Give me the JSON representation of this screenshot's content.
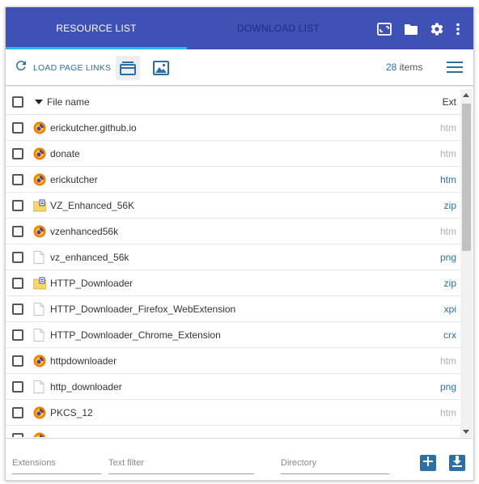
{
  "tabs": [
    {
      "label": "RESOURCE LIST",
      "active": true
    },
    {
      "label": "DOWNLOAD LIST",
      "active": false
    }
  ],
  "header_icons": [
    "fullscreen-icon",
    "folder-icon",
    "settings-icon",
    "more-vert-icon"
  ],
  "toolbar": {
    "load_label": "LOAD PAGE LINKS",
    "count_value": "28",
    "count_suffix": "items"
  },
  "table": {
    "col_name": "File name",
    "col_ext": "Ext",
    "rows": [
      {
        "name": "erickutcher.github.io",
        "ext": "htm",
        "icon": "firefox",
        "ext_dim": true
      },
      {
        "name": "donate",
        "ext": "htm",
        "icon": "firefox",
        "ext_dim": true
      },
      {
        "name": "erickutcher",
        "ext": "htm",
        "icon": "firefox",
        "ext_dim": false
      },
      {
        "name": "VZ_Enhanced_56K",
        "ext": "zip",
        "icon": "zip",
        "ext_dim": false
      },
      {
        "name": "vzenhanced56k",
        "ext": "htm",
        "icon": "firefox",
        "ext_dim": true
      },
      {
        "name": "vz_enhanced_56k",
        "ext": "png",
        "icon": "file",
        "ext_dim": false
      },
      {
        "name": "HTTP_Downloader",
        "ext": "zip",
        "icon": "zip",
        "ext_dim": false
      },
      {
        "name": "HTTP_Downloader_Firefox_WebExtension",
        "ext": "xpi",
        "icon": "file",
        "ext_dim": false
      },
      {
        "name": "HTTP_Downloader_Chrome_Extension",
        "ext": "crx",
        "icon": "file",
        "ext_dim": false
      },
      {
        "name": "httpdownloader",
        "ext": "htm",
        "icon": "firefox",
        "ext_dim": true
      },
      {
        "name": "http_downloader",
        "ext": "png",
        "icon": "file",
        "ext_dim": false
      },
      {
        "name": "PKCS_12",
        "ext": "htm",
        "icon": "firefox",
        "ext_dim": true
      }
    ]
  },
  "footer": {
    "extensions_placeholder": "Extensions",
    "text_filter_placeholder": "Text filter",
    "directory_placeholder": "Directory"
  },
  "colors": {
    "header_bg": "#3f51b5",
    "tab_indicator": "#29b6f6",
    "accent_blue": "#2c6fa5",
    "ext_dim": "#9fb3c8"
  }
}
